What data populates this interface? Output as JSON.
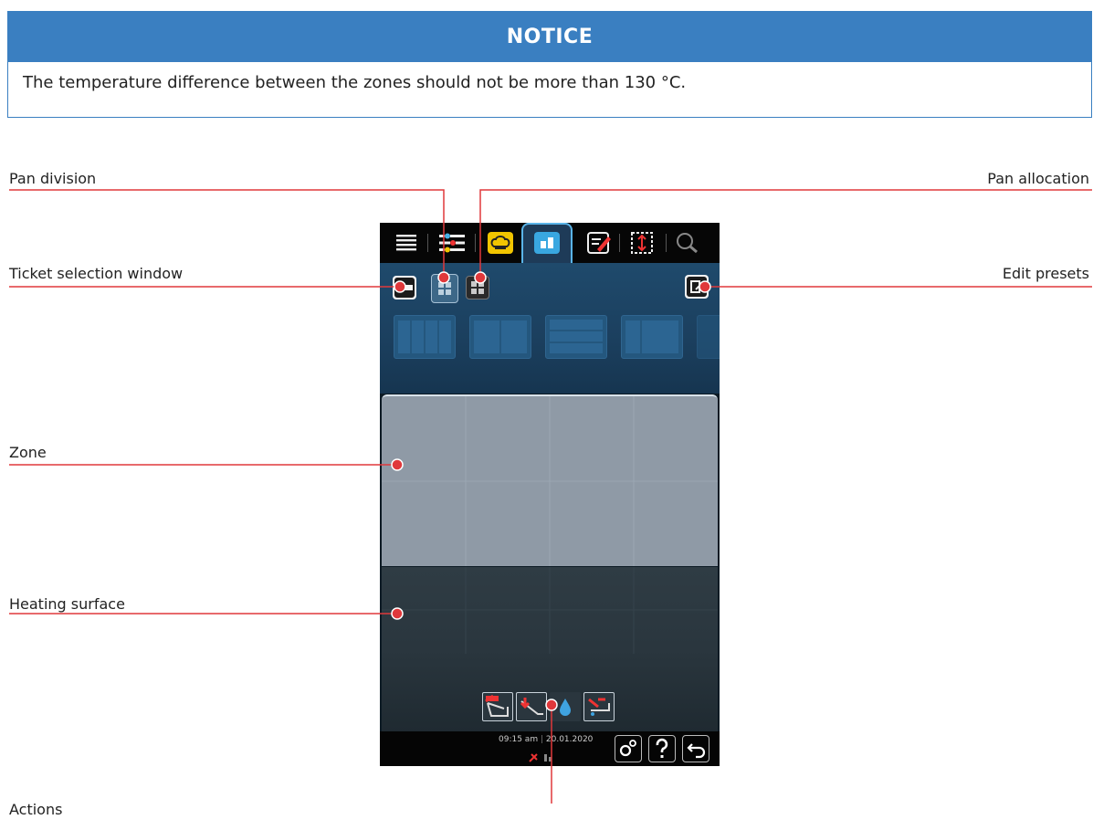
{
  "notice": {
    "title": "NOTICE",
    "text": "The temperature difference between the zones should not be more than 130 °C."
  },
  "labels": {
    "pan_division": "Pan division",
    "pan_allocation": "Pan allocation",
    "ticket_selection": "Ticket selection window",
    "edit_presets": "Edit presets",
    "zone": "Zone",
    "heating_surface": "Heating surface",
    "actions": "Actions"
  },
  "device": {
    "time": "09:15 am",
    "date": "20.01.2020",
    "colors": {
      "accent": "#5ab4e8",
      "panel": "#1f4a6c",
      "zone": "#8f9aa6",
      "heating": "#2f3c44",
      "callout": "#e0383b"
    }
  }
}
